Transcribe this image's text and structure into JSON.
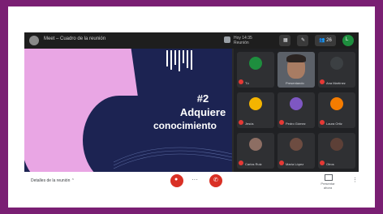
{
  "meeting": {
    "title": "Meet – Cuadro de la reunión",
    "time_line1": "Hoy 14:35",
    "time_line2": "Reunión"
  },
  "toolbar": {
    "chip1": "▦",
    "chip2": "✎",
    "chip3": "👥 26",
    "me": "L"
  },
  "slide": {
    "number": "#2",
    "line1": "Adquiere",
    "line2": "conocimiento"
  },
  "participants": [
    {
      "name": "Tú",
      "initial": "",
      "color": "#1e8e3e"
    },
    {
      "name": "Presentando",
      "initial": "",
      "color": "#5b6068"
    },
    {
      "name": "Ana Martínez",
      "initial": "",
      "color": "#3c4043"
    },
    {
      "name": "Jesús",
      "initial": "",
      "color": "#f4b400"
    },
    {
      "name": "Pedro Gómez",
      "initial": "",
      "color": "#7e57c2"
    },
    {
      "name": "Laura Ortiz",
      "initial": "",
      "color": "#f57c00"
    },
    {
      "name": "Carlos Ruiz",
      "initial": "",
      "color": "#8d6e63"
    },
    {
      "name": "María López",
      "initial": "",
      "color": "#6d4c41"
    },
    {
      "name": "Otros",
      "initial": "",
      "color": "#5d4037"
    }
  ],
  "bottom": {
    "meeting_name": "Detalles de la reunión ⌃",
    "more": "···",
    "present_line1": "Presentar",
    "present_line2": "ahora"
  },
  "colors": {
    "background": "#7a1f73",
    "end_call": "#d93025",
    "slide_bg": "#1c2352",
    "slide_shape": "#e9a6e4"
  }
}
